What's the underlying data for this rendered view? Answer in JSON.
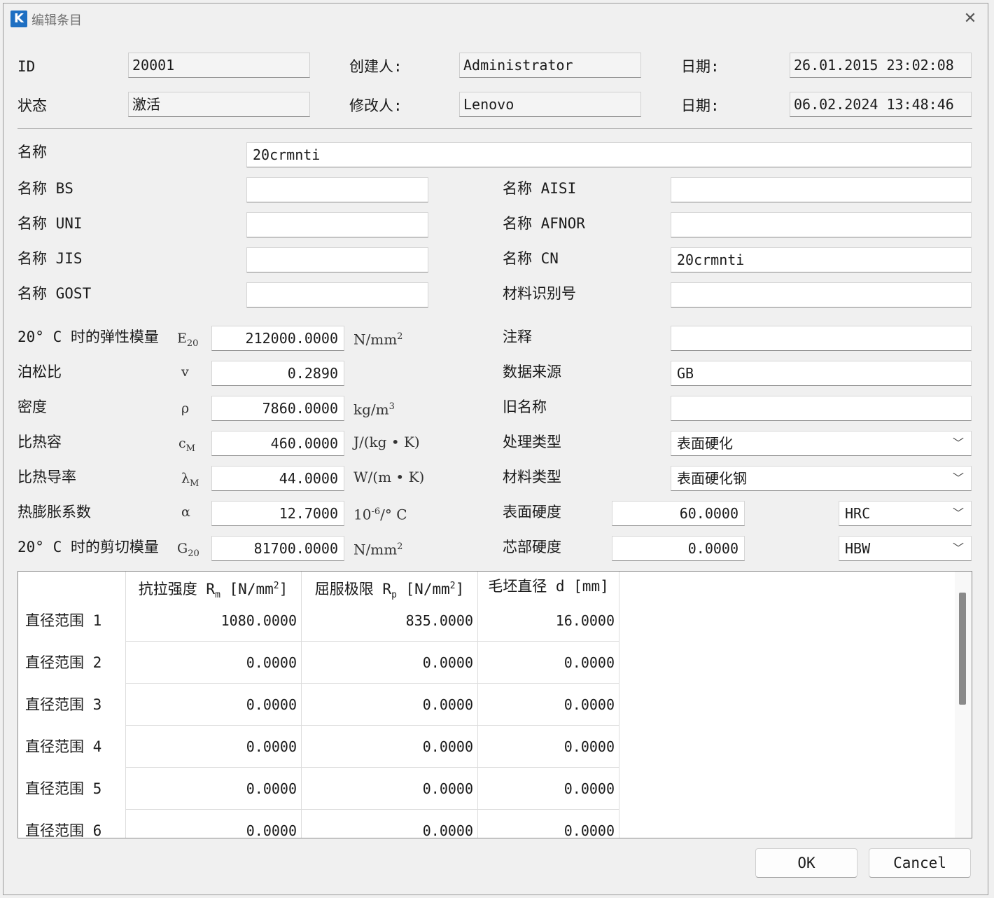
{
  "window": {
    "title": "编辑条目",
    "app_icon_letter": "K",
    "close_glyph": "✕"
  },
  "header": {
    "id_label": "ID",
    "id_value": "20001",
    "creator_label": "创建人:",
    "creator_value": "Administrator",
    "date1_label": "日期:",
    "date1_value": "26.01.2015 23:02:08",
    "status_label": "状态",
    "status_value": "激活",
    "modifier_label": "修改人:",
    "modifier_value": "Lenovo",
    "date2_label": "日期:",
    "date2_value": "06.02.2024 13:48:46"
  },
  "names": {
    "name_label": "名称",
    "name_value": "20crmnti",
    "bs_label": "名称 BS",
    "bs_value": "",
    "uni_label": "名称 UNI",
    "uni_value": "",
    "jis_label": "名称 JIS",
    "jis_value": "",
    "gost_label": "名称 GOST",
    "gost_value": "",
    "aisi_label": "名称 AISI",
    "aisi_value": "",
    "afnor_label": "名称 AFNOR",
    "afnor_value": "",
    "cn_label": "名称 CN",
    "cn_value": "20crmnti",
    "material_id_label": "材料识别号",
    "material_id_value": ""
  },
  "props": {
    "elastic_label": "20° C 时的弹性模量",
    "elastic_sym": "E",
    "elastic_sub": "20",
    "elastic_value": "212000.0000",
    "elastic_unit": "N/mm",
    "elastic_unit_sup": "2",
    "poisson_label": "泊松比",
    "poisson_sym": "v",
    "poisson_value": "0.2890",
    "density_label": "密度",
    "density_sym": "ρ",
    "density_value": "7860.0000",
    "density_unit": "kg/m",
    "density_unit_sup": "3",
    "heat_cap_label": "比热容",
    "heat_cap_sym": "c",
    "heat_cap_sub": "M",
    "heat_cap_value": "460.0000",
    "heat_cap_unit": "J/(kg • K)",
    "conduct_label": "比热导率",
    "conduct_sym": "λ",
    "conduct_sub": "M",
    "conduct_value": "44.0000",
    "conduct_unit": "W/(m • K)",
    "expansion_label": "热膨胀系数",
    "expansion_sym": "α",
    "expansion_value": "12.7000",
    "expansion_unit_pre": "10",
    "expansion_unit_sup": "-6",
    "expansion_unit_post": "/° C",
    "shear_label": "20° C 时的剪切模量",
    "shear_sym": "G",
    "shear_sub": "20",
    "shear_value": "81700.0000",
    "shear_unit": "N/mm",
    "shear_unit_sup": "2"
  },
  "right": {
    "note_label": "注释",
    "note_value": "",
    "source_label": "数据来源",
    "source_value": "GB",
    "old_name_label": "旧名称",
    "old_name_value": "",
    "treatment_label": "处理类型",
    "treatment_value": "表面硬化",
    "material_type_label": "材料类型",
    "material_type_value": "表面硬化钢",
    "surface_hardness_label": "表面硬度",
    "surface_hardness_value": "60.0000",
    "surface_hardness_unit": "HRC",
    "core_hardness_label": "芯部硬度",
    "core_hardness_value": "0.0000",
    "core_hardness_unit": "HBW",
    "chevron": "﹀"
  },
  "table": {
    "col1_pre": "抗拉强度 R",
    "col1_sub": "m",
    "col1_post": " [N/mm",
    "col1_sup": "2",
    "col1_end": "]",
    "col2_pre": "屈服极限 R",
    "col2_sub": "p",
    "col2_post": " [N/mm",
    "col2_sup": "2",
    "col2_end": "]",
    "col3": "毛坯直径 d [mm]",
    "rows": [
      {
        "label": "直径范围 1",
        "c1": "1080.0000",
        "c2": "835.0000",
        "c3": "16.0000"
      },
      {
        "label": "直径范围 2",
        "c1": "0.0000",
        "c2": "0.0000",
        "c3": "0.0000"
      },
      {
        "label": "直径范围 3",
        "c1": "0.0000",
        "c2": "0.0000",
        "c3": "0.0000"
      },
      {
        "label": "直径范围 4",
        "c1": "0.0000",
        "c2": "0.0000",
        "c3": "0.0000"
      },
      {
        "label": "直径范围 5",
        "c1": "0.0000",
        "c2": "0.0000",
        "c3": "0.0000"
      },
      {
        "label": "直径范围 6",
        "c1": "0.0000",
        "c2": "0.0000",
        "c3": "0.0000"
      }
    ]
  },
  "buttons": {
    "ok": "OK",
    "cancel": "Cancel"
  }
}
